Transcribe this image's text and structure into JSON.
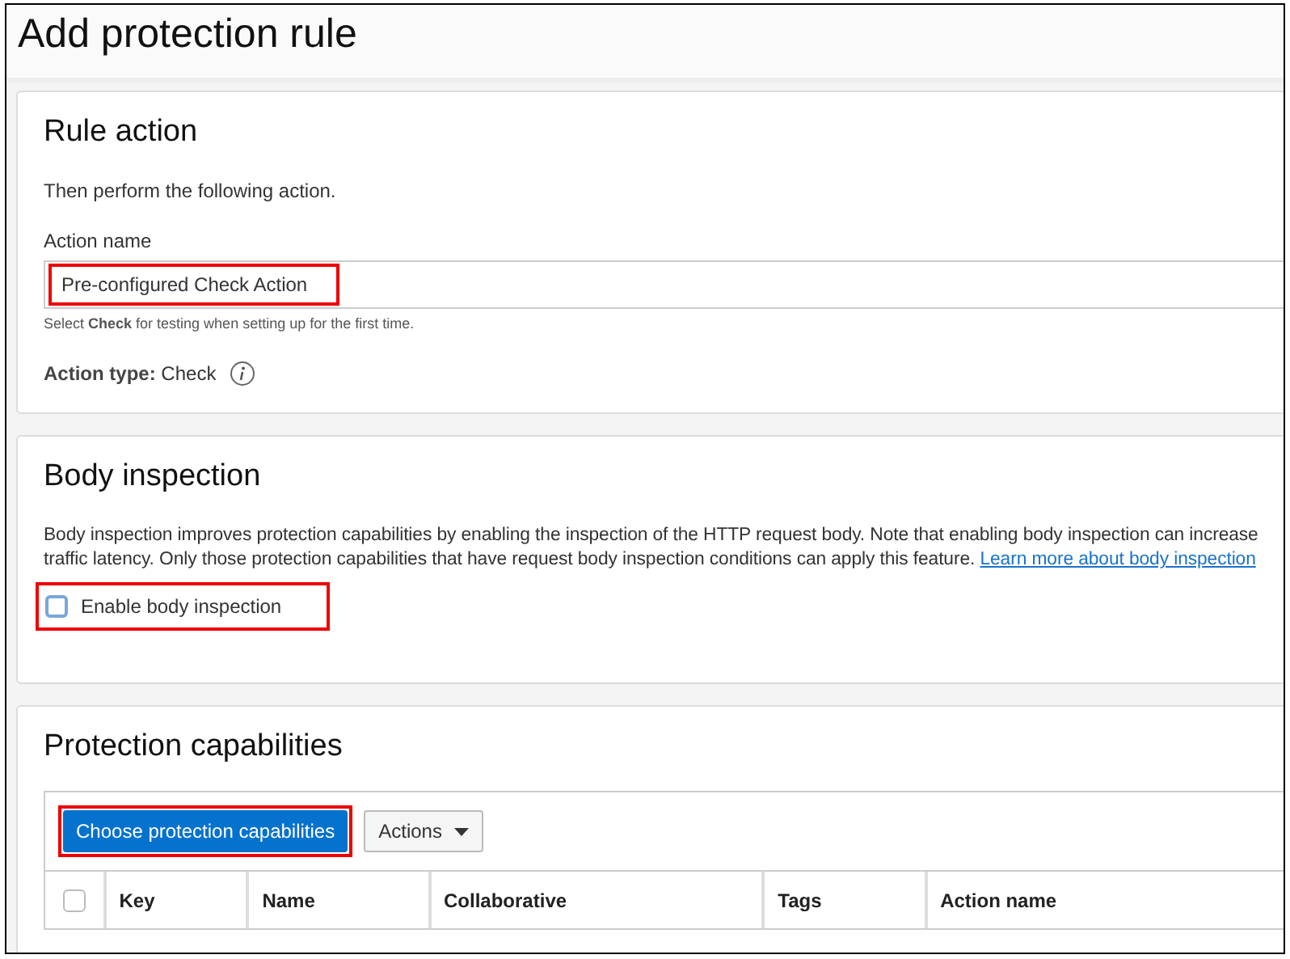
{
  "page": {
    "title": "Add protection rule"
  },
  "rule_action": {
    "heading": "Rule action",
    "intro": "Then perform the following action.",
    "field_label": "Action name",
    "field_value": "Pre-configured Check Action",
    "help": "Select **Check** for testing when setting up for the first time.",
    "type_label": "Action type:",
    "type_value": "Check"
  },
  "body_inspection": {
    "heading": "Body inspection",
    "description_lines": [
      "Body inspection improves protection capabilities by enabling the inspection of the HTTP request body. Note that enabling body inspection can increase",
      "traffic latency. Only those protection capabilities that have request body inspection conditions can apply this feature."
    ],
    "link": "Learn more about body inspection",
    "checkbox": {
      "label": "Enable body inspection",
      "checked": false
    }
  },
  "protection_capabilities": {
    "heading": "Protection capabilities",
    "primary_button": "Choose protection capabilities",
    "actions_button": "Actions",
    "table": {
      "select_all_checked": false,
      "columns": [
        "Key",
        "Name",
        "Collaborative",
        "Tags",
        "Action name"
      ]
    }
  }
}
